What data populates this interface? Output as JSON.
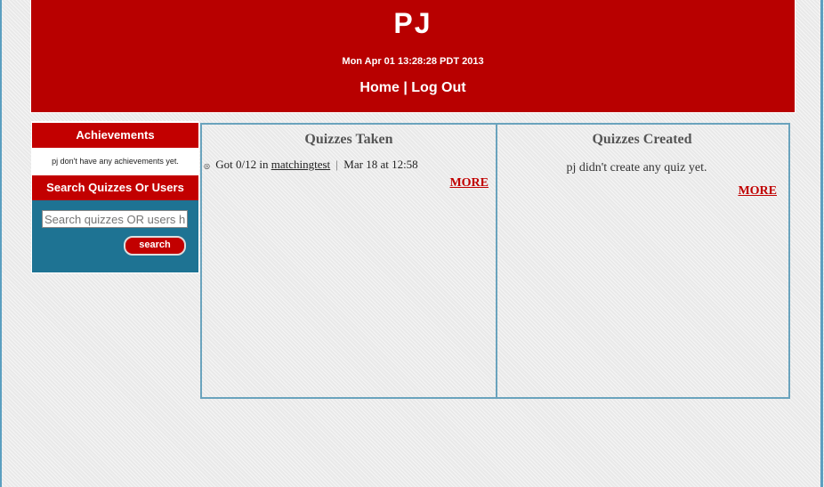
{
  "header": {
    "title": "PJ",
    "date": "Mon Apr 01 13:28:28 PDT 2013",
    "nav": {
      "home": "Home",
      "separator": "|",
      "logout": "Log Out"
    }
  },
  "sidebar": {
    "achievements_heading": "Achievements",
    "achievements_text": "pj don't have any achievements yet.",
    "search_heading": "Search Quizzes Or Users",
    "search_placeholder": "Search quizzes OR users here",
    "search_button": "search"
  },
  "quizzes_taken": {
    "heading": "Quizzes Taken",
    "items": [
      {
        "result": "Got 0/12 in",
        "quiz": "matchingtest",
        "separator": "|",
        "date": "Mar 18 at 12:58"
      }
    ],
    "more": "MORE"
  },
  "quizzes_created": {
    "heading": "Quizzes Created",
    "empty_text": "pj didn't create any quiz yet.",
    "more": "MORE"
  },
  "colors": {
    "brand_red": "#b80000",
    "panel_border": "#6aa3bd",
    "sidebar_blue": "#1e7393"
  }
}
